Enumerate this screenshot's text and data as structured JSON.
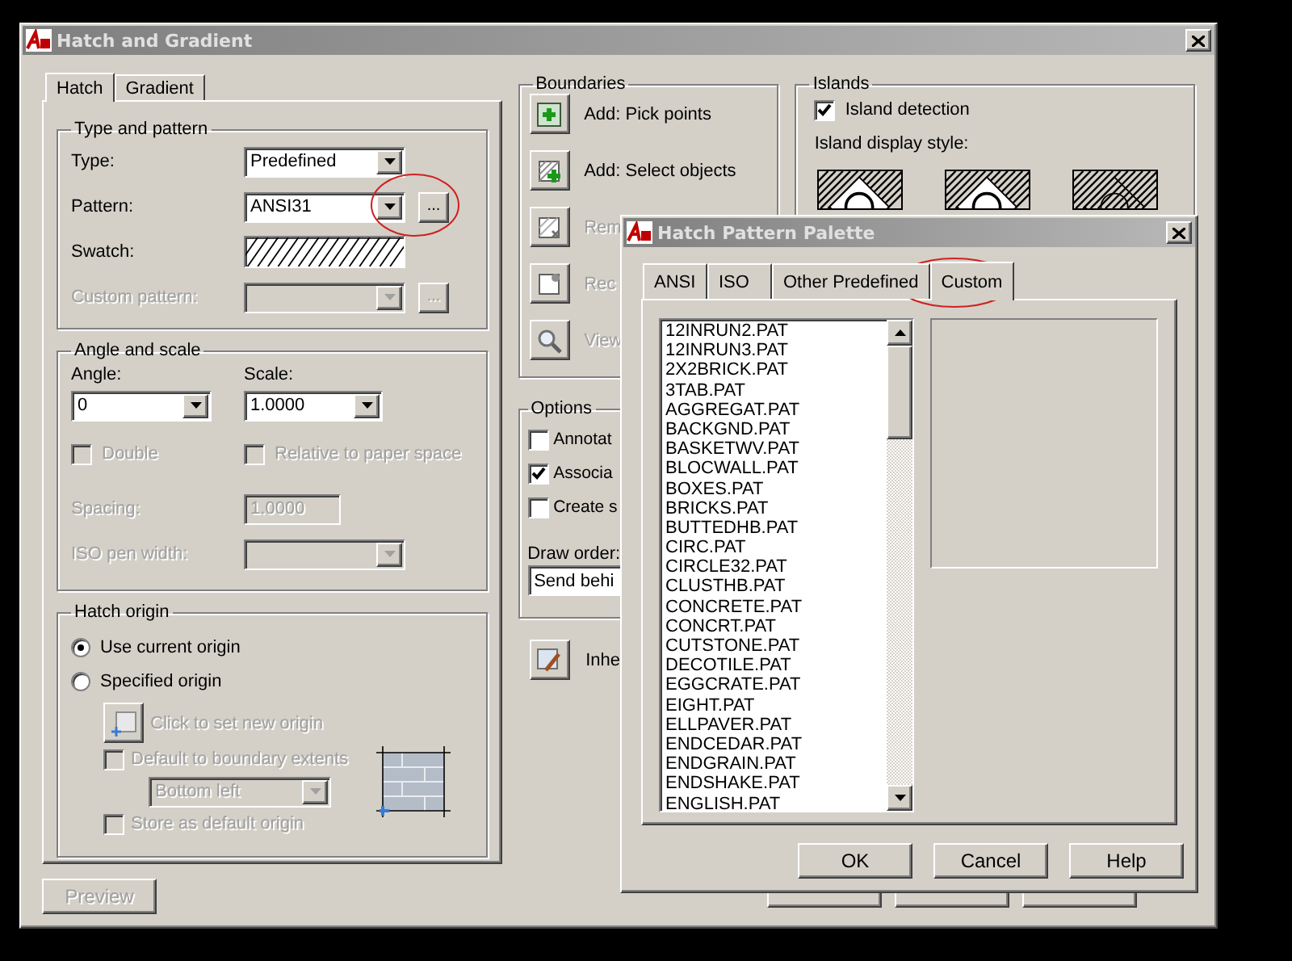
{
  "window": {
    "title": "Hatch and Gradient"
  },
  "tabs": [
    {
      "label": "Hatch",
      "selected": true
    },
    {
      "label": "Gradient",
      "selected": false
    }
  ],
  "type_and_pattern": {
    "title": "Type and pattern",
    "rows": [
      {
        "kind": "combo",
        "label": "Type:",
        "value": "Predefined",
        "disabled": false
      },
      {
        "kind": "combo",
        "label": "Pattern:",
        "value": "ANSI31",
        "browse": "...",
        "disabled": false
      },
      {
        "kind": "swatch",
        "label": "Swatch:"
      },
      {
        "kind": "combo",
        "label": "Custom pattern:",
        "browse": "...",
        "disabled": true
      }
    ]
  },
  "angle_and_scale": {
    "title": "Angle and scale",
    "angle": {
      "label": "Angle:",
      "value": "0"
    },
    "scale": {
      "label": "Scale:",
      "value": "1.0000"
    },
    "checkboxes": [
      {
        "label": "Double",
        "checked": false,
        "disabled": true
      },
      {
        "label": "Relative to paper space",
        "checked": false,
        "disabled": true
      }
    ],
    "spacing": {
      "label": "Spacing:",
      "value": "1.0000",
      "disabled": true
    },
    "iso_pen_width": {
      "label": "ISO pen width:",
      "disabled": true
    }
  },
  "hatch_origin": {
    "title": "Hatch origin",
    "radios": [
      {
        "label": "Use current origin",
        "selected": true
      },
      {
        "label": "Specified origin",
        "selected": false
      }
    ],
    "set_origin": {
      "label": "Click to set new origin",
      "disabled": true
    },
    "default_extents": {
      "label": "Default to boundary extents",
      "checked": false,
      "disabled": true
    },
    "position": {
      "value": "Bottom left",
      "disabled": true
    },
    "store_default": {
      "label": "Store as default origin",
      "checked": false,
      "disabled": true
    }
  },
  "boundaries": {
    "title": "Boundaries",
    "items": [
      {
        "kind": "pick",
        "label": "Add: Pick points",
        "disabled": false
      },
      {
        "kind": "select",
        "label": "Add: Select objects",
        "disabled": false
      },
      {
        "kind": "remove",
        "label": "Rem",
        "disabled": true
      },
      {
        "kind": "recreate",
        "label": "Rec",
        "disabled": true
      },
      {
        "kind": "view",
        "label": "View",
        "disabled": true
      }
    ]
  },
  "options": {
    "title": "Options",
    "checkboxes": [
      {
        "label": "Annotat",
        "checked": false
      },
      {
        "label": "Associa",
        "checked": true
      },
      {
        "label": "Create s",
        "checked": false
      }
    ],
    "draw_order": {
      "label": "Draw order:",
      "value": "Send behi"
    }
  },
  "inherit": {
    "label": "Inhe"
  },
  "islands": {
    "title": "Islands",
    "detection": {
      "label": "Island detection",
      "checked": true
    },
    "style_label": "Island display style:",
    "styles": [
      {
        "kind": "normal"
      },
      {
        "kind": "outer"
      },
      {
        "kind": "ignore"
      }
    ]
  },
  "preview_button": {
    "label": "Preview",
    "disabled": true
  },
  "palette": {
    "title": "Hatch Pattern Palette",
    "tabs": [
      {
        "label": "ANSI",
        "selected": false
      },
      {
        "label": "ISO",
        "selected": false
      },
      {
        "label": "Other Predefined",
        "selected": false
      },
      {
        "label": "Custom",
        "selected": true
      }
    ],
    "files": [
      "12INRUN2.PAT",
      "12INRUN3.PAT",
      "2X2BRICK.PAT",
      "3TAB.PAT",
      "AGGREGAT.PAT",
      "BACKGND.PAT",
      "BASKETWV.PAT",
      "BLOCWALL.PAT",
      "BOXES.PAT",
      "BRICKS.PAT",
      "BUTTEDHB.PAT",
      "CIRC.PAT",
      "CIRCLE32.PAT",
      "CLUSTHB.PAT",
      "CONCRETE.PAT",
      "CONCRT.PAT",
      "CUTSTONE.PAT",
      "DECOTILE.PAT",
      "EGGCRATE.PAT",
      "EIGHT.PAT",
      "ELLPAVER.PAT",
      "ENDCEDAR.PAT",
      "ENDGRAIN.PAT",
      "ENDSHAKE.PAT",
      "ENGLISH.PAT"
    ],
    "buttons": [
      {
        "label": "OK"
      },
      {
        "label": "Cancel"
      },
      {
        "label": "Help"
      }
    ]
  }
}
